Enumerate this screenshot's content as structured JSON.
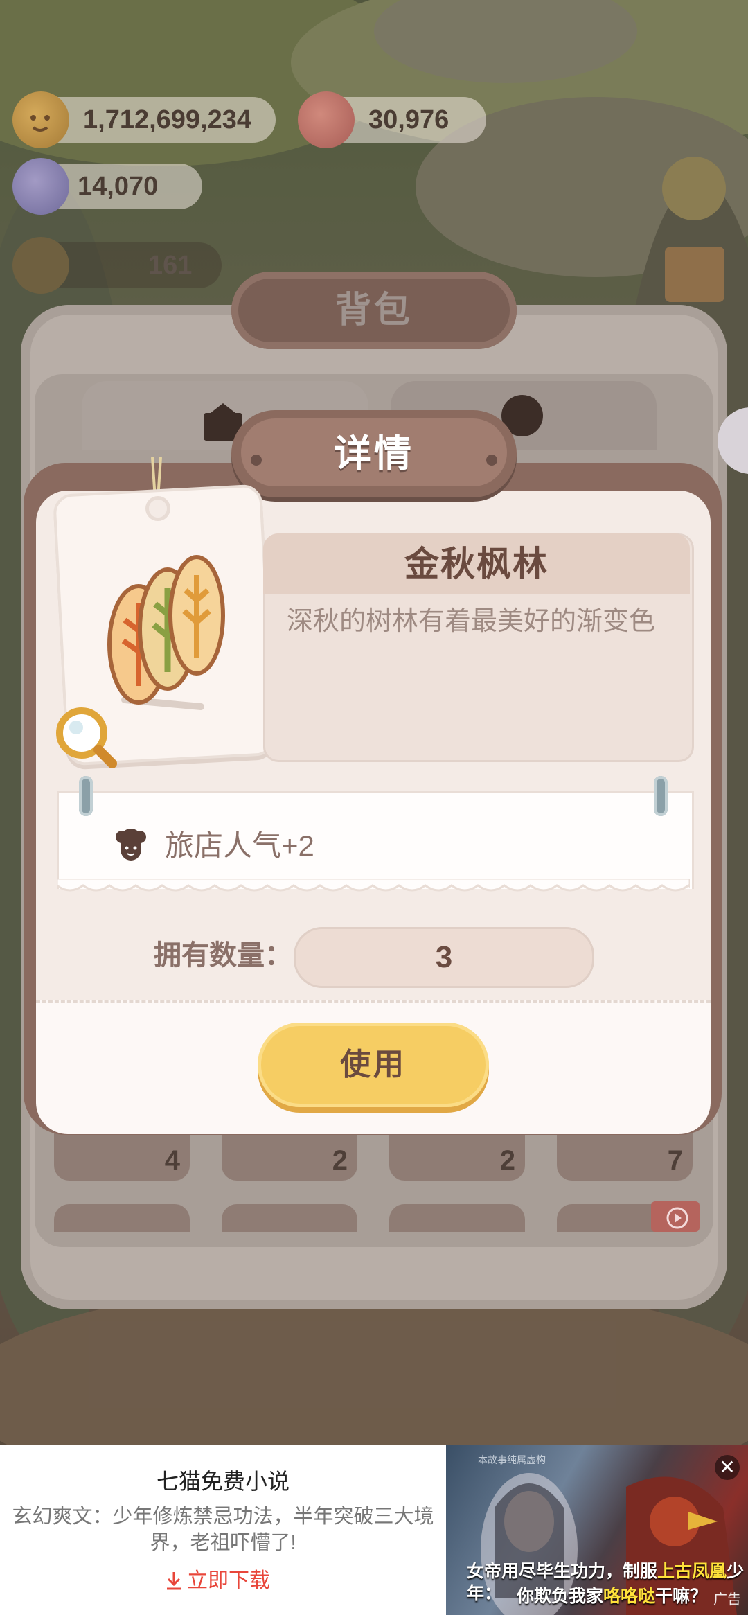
{
  "hud": {
    "coins": "1,712,699,234",
    "hearts": "30,976",
    "gems": "14,070",
    "faded_count": "161"
  },
  "backpack": {
    "title": "背包",
    "cell_counts": [
      "4",
      "2",
      "2",
      "7"
    ]
  },
  "details": {
    "title": "详情",
    "item_name": "金秋枫林",
    "item_desc": "深秋的树林有着最美好的渐变色",
    "effect": "旅店人气+2",
    "qty_label": "拥有数量：",
    "qty_value": "3",
    "use_label": "使用"
  },
  "ad": {
    "app_name": "七猫免费小说",
    "desc": "玄幻爽文：少年修炼禁忌功法，半年突破三大境界，老祖吓懵了!",
    "download": "立即下载",
    "subtitle_line1_a": "女帝用尽毕生功力，制服",
    "subtitle_line1_b": "上古凤凰",
    "subtitle_line1_c": "少年：",
    "subtitle_line2_a": "你欺负我家",
    "subtitle_line2_b": "咯咯哒",
    "subtitle_line2_c": "干嘛？",
    "badge": "广告",
    "tiny_notice": "本故事纯属虚构",
    "close": "✕"
  },
  "colors": {
    "modal_frame": "#8a6a5f",
    "button_yellow": "#f6cd63",
    "title_text": "#6a4a3f",
    "ad_link": "#e8463a"
  },
  "icons": [
    "coin-icon",
    "heart-cookie-icon",
    "gem-icon",
    "bag-tab-icon",
    "decor-tab-icon",
    "leaf-item-icon",
    "magnifier-icon",
    "popularity-icon",
    "close-icon",
    "download-icon"
  ]
}
